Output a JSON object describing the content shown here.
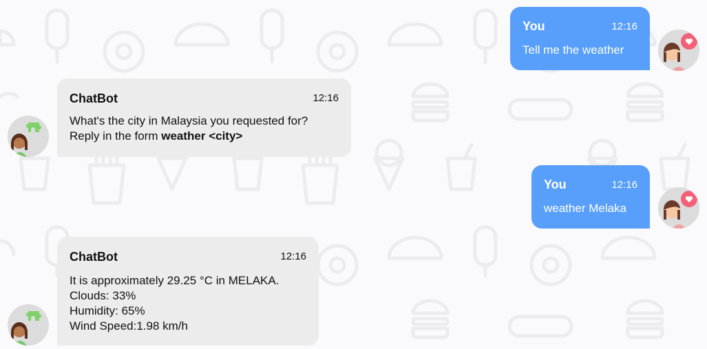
{
  "colors": {
    "user_bubble": "#579ffb",
    "bot_bubble": "#ececec",
    "background": "#fafafc",
    "text_dark": "#111111",
    "text_light": "#ffffff"
  },
  "messages": [
    {
      "sender": "You",
      "time": "12:16",
      "text": "Tell me the weather",
      "avatar_icon": "user-avatar-heart-icon"
    },
    {
      "sender": "ChatBot",
      "time": "12:16",
      "line1": "What's the city in Malaysia you requested for?",
      "line2_prefix": "Reply in the form ",
      "line2_bold": "weather <city>",
      "avatar_icon": "bot-avatar-puzzle-icon"
    },
    {
      "sender": "You",
      "time": "12:16",
      "text": "weather Melaka",
      "avatar_icon": "user-avatar-heart-icon"
    },
    {
      "sender": "ChatBot",
      "time": "12:16",
      "lines": [
        "It is approximately 29.25 °C in MELAKA.",
        "Clouds: 33%",
        "Humidity: 65%",
        "Wind Speed:1.98 km/h"
      ],
      "avatar_icon": "bot-avatar-puzzle-icon"
    }
  ]
}
